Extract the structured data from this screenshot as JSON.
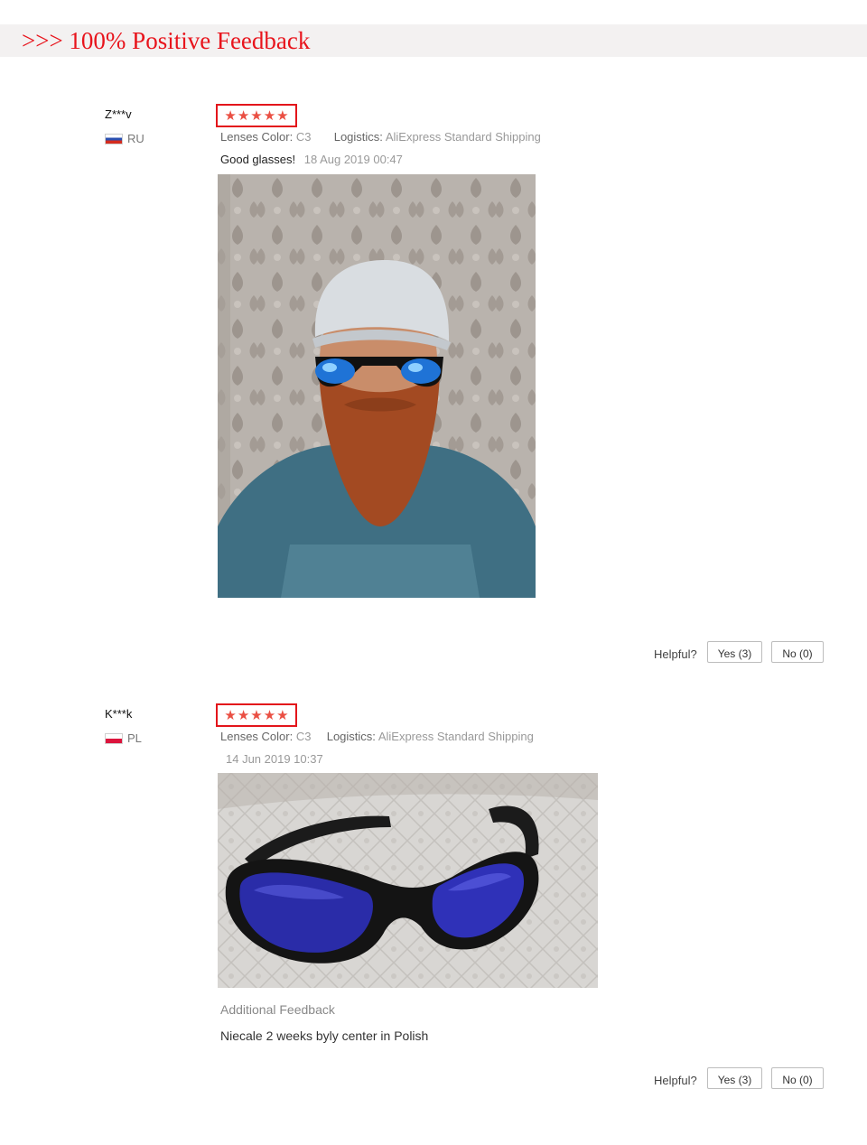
{
  "banner": {
    "text": ">>> 100% Positive Feedback"
  },
  "reviews": [
    {
      "user": "Z***v",
      "country": "RU",
      "rating": 5,
      "lenses_label": "Lenses Color:",
      "lenses_value": "C3",
      "logistics_label": "Logistics:",
      "logistics_value": "AliExpress Standard Shipping",
      "comment": "Good glasses!",
      "date": "18 Aug 2019 00:47",
      "helpful_label": "Helpful?",
      "yes_label": "Yes (3)",
      "no_label": "No (0)"
    },
    {
      "user": "K***k",
      "country": "PL",
      "rating": 5,
      "lenses_label": "Lenses Color:",
      "lenses_value": "C3",
      "logistics_label": "Logistics:",
      "logistics_value": "AliExpress Standard Shipping",
      "date": "14 Jun 2019 10:37",
      "additional_title": "Additional Feedback",
      "additional_text": "Niecale 2 weeks byly center in Polish",
      "helpful_label": "Helpful?",
      "yes_label": "Yes (3)",
      "no_label": "No (0)"
    }
  ]
}
